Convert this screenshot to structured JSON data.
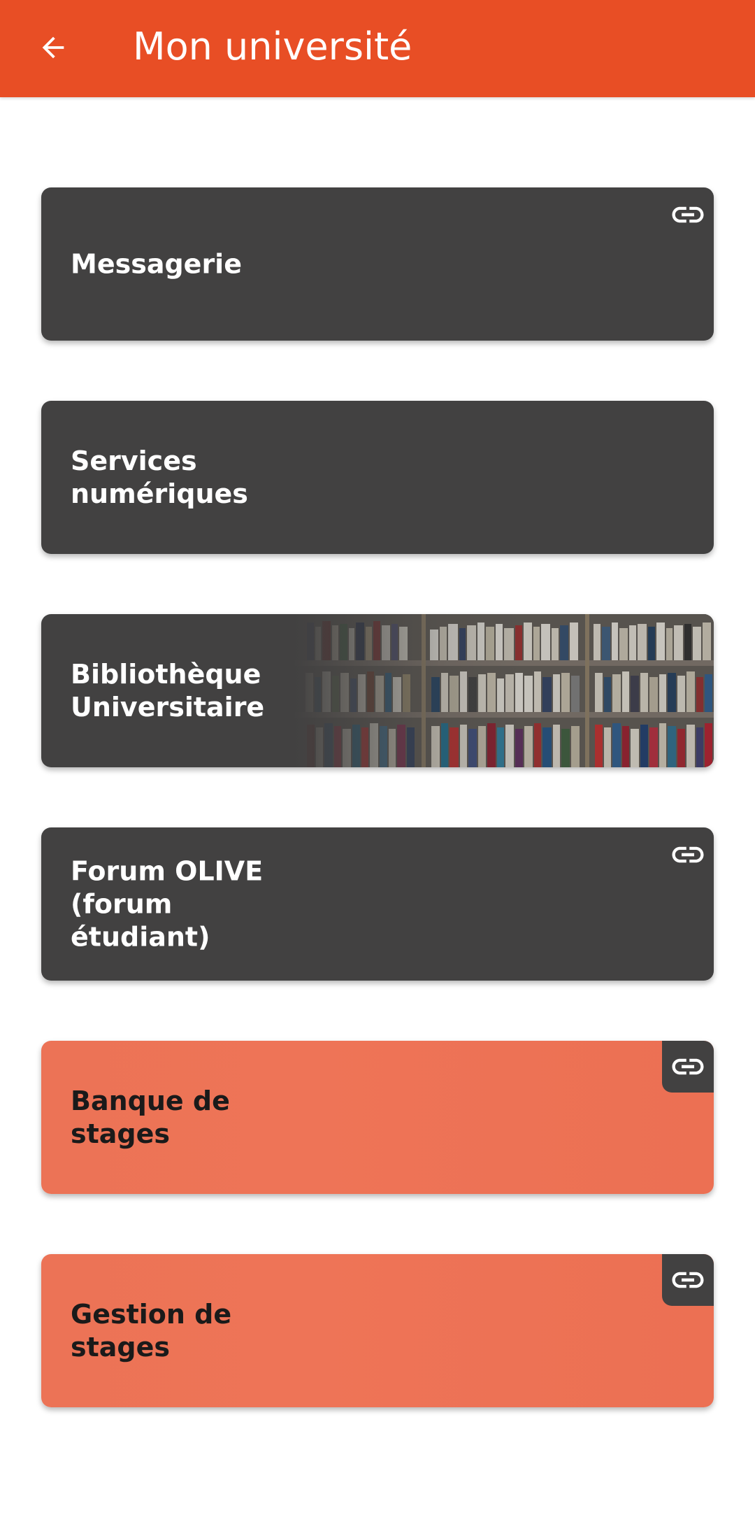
{
  "app_bar": {
    "title": "Mon université",
    "back_icon": "arrow-left-icon",
    "background_color": "#e84e25"
  },
  "cards": [
    {
      "id": "messagerie",
      "label": "Messagerie",
      "has_link": true,
      "style": "dark"
    },
    {
      "id": "services",
      "label": "Services numériques",
      "has_link": false,
      "style": "dark"
    },
    {
      "id": "bibliotheque",
      "label": "Bibliothèque Universitaire",
      "has_link": false,
      "style": "dark-image",
      "image": "bookshelf"
    },
    {
      "id": "forum",
      "label": "Forum OLIVE (forum étudiant)",
      "has_link": true,
      "style": "dark"
    },
    {
      "id": "banque",
      "label": "Banque de stages",
      "has_link": true,
      "style": "orange"
    },
    {
      "id": "gestion",
      "label": "Gestion de stages",
      "has_link": true,
      "style": "orange"
    }
  ],
  "colors": {
    "dark_card": "#424141",
    "orange_card": "#ee7457",
    "accent": "#e84e25"
  }
}
